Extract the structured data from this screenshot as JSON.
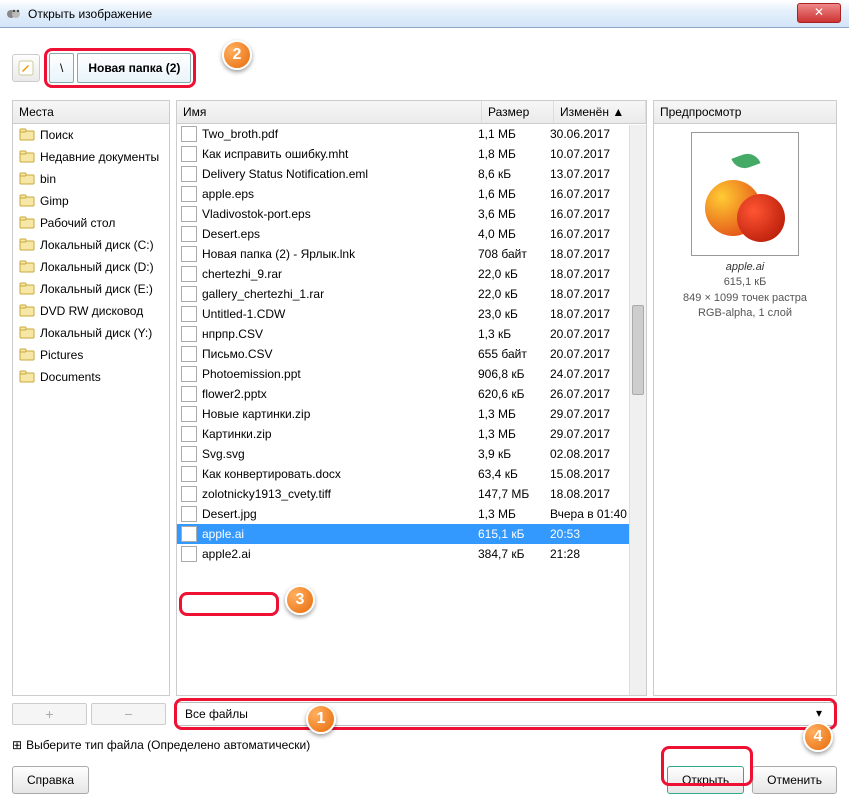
{
  "window": {
    "title": "Открыть изображение",
    "close_glyph": "✕"
  },
  "path": {
    "segments": [
      "\\",
      "Новая папка (2)"
    ]
  },
  "places": {
    "header": "Места",
    "items": [
      {
        "label": "Поиск"
      },
      {
        "label": "Недавние документы"
      },
      {
        "label": "bin"
      },
      {
        "label": "Gimp"
      },
      {
        "label": "Рабочий стол"
      },
      {
        "label": "Локальный диск (C:)"
      },
      {
        "label": "Локальный диск (D:)"
      },
      {
        "label": "Локальный диск (E:)"
      },
      {
        "label": "DVD RW дисковод"
      },
      {
        "label": "Локальный диск (Y:)"
      },
      {
        "label": "Pictures"
      },
      {
        "label": "Documents"
      }
    ],
    "add_btn": "+",
    "remove_btn": "−"
  },
  "files": {
    "columns": {
      "name": "Имя",
      "size": "Размер",
      "modified": "Изменён"
    },
    "sort_indicator": "▲",
    "rows": [
      {
        "name": "Two_broth.pdf",
        "size": "1,1 МБ",
        "date": "30.06.2017",
        "selected": false
      },
      {
        "name": "Как исправить ошибку.mht",
        "size": "1,8 МБ",
        "date": "10.07.2017",
        "selected": false
      },
      {
        "name": "Delivery Status Notification.eml",
        "size": "8,6 кБ",
        "date": "13.07.2017",
        "selected": false
      },
      {
        "name": "apple.eps",
        "size": "1,6 МБ",
        "date": "16.07.2017",
        "selected": false
      },
      {
        "name": "Vladivostok-port.eps",
        "size": "3,6 МБ",
        "date": "16.07.2017",
        "selected": false
      },
      {
        "name": "Desert.eps",
        "size": "4,0 МБ",
        "date": "16.07.2017",
        "selected": false
      },
      {
        "name": "Новая папка (2) - Ярлык.lnk",
        "size": "708 байт",
        "date": "18.07.2017",
        "selected": false
      },
      {
        "name": "chertezhi_9.rar",
        "size": "22,0 кБ",
        "date": "18.07.2017",
        "selected": false
      },
      {
        "name": "gallery_chertezhi_1.rar",
        "size": "22,0 кБ",
        "date": "18.07.2017",
        "selected": false
      },
      {
        "name": "Untitled-1.CDW",
        "size": "23,0 кБ",
        "date": "18.07.2017",
        "selected": false
      },
      {
        "name": "нпрпр.CSV",
        "size": "1,3 кБ",
        "date": "20.07.2017",
        "selected": false
      },
      {
        "name": "Письмо.CSV",
        "size": "655 байт",
        "date": "20.07.2017",
        "selected": false
      },
      {
        "name": "Photoemission.ppt",
        "size": "906,8 кБ",
        "date": "24.07.2017",
        "selected": false
      },
      {
        "name": "flower2.pptx",
        "size": "620,6 кБ",
        "date": "26.07.2017",
        "selected": false
      },
      {
        "name": "Новые картинки.zip",
        "size": "1,3 МБ",
        "date": "29.07.2017",
        "selected": false
      },
      {
        "name": "Картинки.zip",
        "size": "1,3 МБ",
        "date": "29.07.2017",
        "selected": false
      },
      {
        "name": "Svg.svg",
        "size": "3,9 кБ",
        "date": "02.08.2017",
        "selected": false
      },
      {
        "name": "Как конвертировать.docx",
        "size": "63,4 кБ",
        "date": "15.08.2017",
        "selected": false
      },
      {
        "name": "zolotnicky1913_cvety.tiff",
        "size": "147,7 МБ",
        "date": "18.08.2017",
        "selected": false
      },
      {
        "name": "Desert.jpg",
        "size": "1,3 МБ",
        "date": "Вчера в 01:40",
        "selected": false
      },
      {
        "name": "apple.ai",
        "size": "615,1 кБ",
        "date": "20:53",
        "selected": true
      },
      {
        "name": "apple2.ai",
        "size": "384,7 кБ",
        "date": "21:28",
        "selected": false
      }
    ]
  },
  "preview": {
    "header": "Предпросмотр",
    "filename": "apple.ai",
    "size": "615,1 кБ",
    "dimensions": "849 × 1099 точек растра",
    "mode": "RGB-alpha, 1 слой"
  },
  "filter": {
    "label": "Все файлы"
  },
  "expand": {
    "glyph": "⊞",
    "label": "Выберите тип файла (Определено автоматически)"
  },
  "buttons": {
    "help": "Справка",
    "open": "Открыть",
    "cancel": "Отменить"
  },
  "callouts": {
    "c1": "1",
    "c2": "2",
    "c3": "3",
    "c4": "4"
  }
}
